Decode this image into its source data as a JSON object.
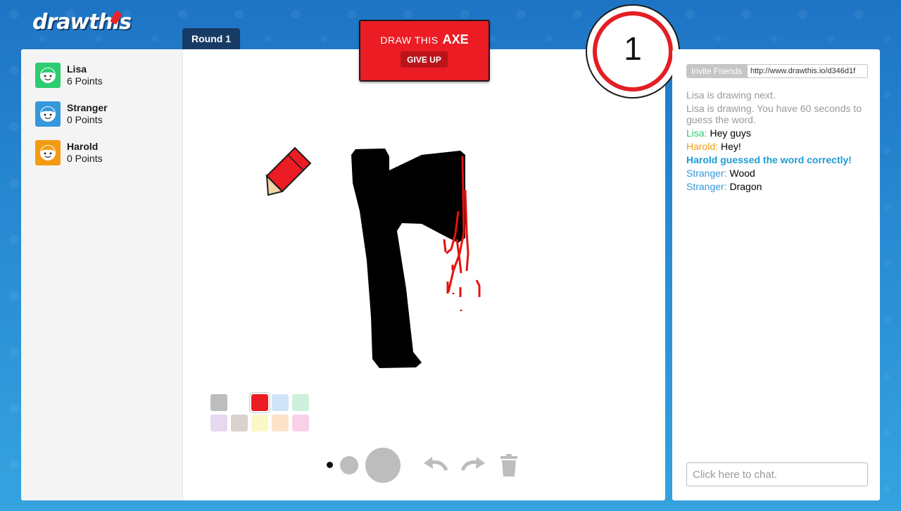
{
  "app": {
    "logo": "drawthis"
  },
  "round": {
    "label": "Round 1"
  },
  "challenge": {
    "prefix": "DRAW THIS",
    "word": "AXE",
    "give_up_label": "GIVE UP"
  },
  "timer": {
    "value": "1"
  },
  "players": [
    {
      "name": "Lisa",
      "points": "6 Points",
      "color": "#2ecc71"
    },
    {
      "name": "Stranger",
      "points": "0 Points",
      "color": "#3498db"
    },
    {
      "name": "Harold",
      "points": "0 Points",
      "color": "#f39c12"
    }
  ],
  "palette": {
    "colors": [
      "#bdbdbd",
      "#ffffff",
      "#ec1c24",
      "#cfe5f7",
      "#cdf1da",
      "#e7d7ef",
      "#dcd2cc",
      "#fbf7c7",
      "#fbe2c8",
      "#f9d1e6"
    ],
    "selected_index": 2
  },
  "brush_sizes": [
    "small",
    "medium",
    "large"
  ],
  "tools": {
    "undo": "undo-icon",
    "redo": "redo-icon",
    "clear": "trash-icon"
  },
  "chat": {
    "invite_label": "Invite Friends",
    "invite_link": "http://www.drawthis.io/d346d1f",
    "input_placeholder": "Click here to chat.",
    "messages": [
      {
        "type": "system",
        "text": "Lisa is drawing next."
      },
      {
        "type": "system",
        "text": "Lisa is drawing. You have 60 seconds to guess the word."
      },
      {
        "type": "chat",
        "name": "Lisa",
        "name_color": "#2ecc71",
        "text": "Hey guys"
      },
      {
        "type": "chat",
        "name": "Harold",
        "name_color": "#f39c12",
        "text": "Hey!"
      },
      {
        "type": "correct",
        "text": "Harold guessed the word correctly!"
      },
      {
        "type": "chat",
        "name": "Stranger",
        "name_color": "#3498db",
        "text": "Wood"
      },
      {
        "type": "chat",
        "name": "Stranger",
        "name_color": "#3498db",
        "text": "Dragon"
      }
    ]
  }
}
